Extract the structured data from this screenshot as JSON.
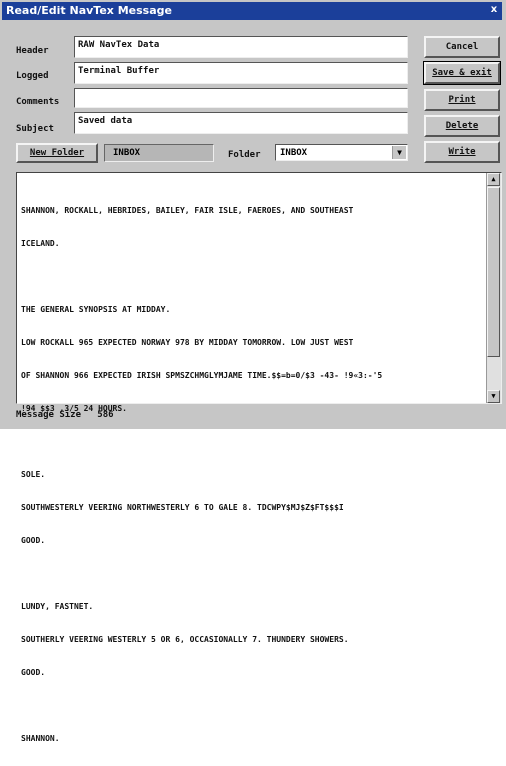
{
  "window": {
    "title": "Read/Edit NavTex Message",
    "close_glyph": "x"
  },
  "form": {
    "header_label": "Header",
    "header_value": "RAW NavTex Data",
    "logged_label": "Logged",
    "logged_value": "Terminal Buffer",
    "comments_label": "Comments",
    "comments_value": "",
    "subject_label": "Subject",
    "subject_value": "Saved data"
  },
  "buttons": {
    "cancel": "Cancel",
    "save_exit": "Save & exit",
    "print": "Print",
    "delete": "Delete",
    "write": "Write",
    "new_folder": "New Folder"
  },
  "folder": {
    "current": "INBOX",
    "label": "Folder",
    "selected": "INBOX"
  },
  "message": {
    "lines": [
      "SHANNON, ROCKALL, HEBRIDES, BAILEY, FAIR ISLE, FAEROES, AND SOUTHEAST",
      "ICELAND.",
      "",
      "THE GENERAL SYNOPSIS AT MIDDAY.",
      "LOW ROCKALL 965 EXPECTED NORWAY 978 BY MIDDAY TOMORROW. LOW JUST WEST",
      "OF SHANNON 966 EXPECTED IRISH SPMSZCHMGLYMJAME TIME.$$=b=0/$3 -43- !9«3:-'5",
      "!94 $$3 ,3/5 24 HOURS.",
      "",
      "SOLE.",
      "SOUTHWESTERLY VEERING NORTHWESTERLY 6 TO GALE 8. TDCWPY$MJ$Z$FT$$$I",
      "GOOD.",
      "",
      "LUNDY, FASTNET.",
      "SOUTHERLY VEERING WESTERLY 5 OR 6, OCCASIONALLY 7. THUNDERY SHOWERS.",
      "GOOD.",
      "",
      "SHANNON."
    ]
  },
  "status": {
    "label": "Message Size",
    "value": "586"
  }
}
